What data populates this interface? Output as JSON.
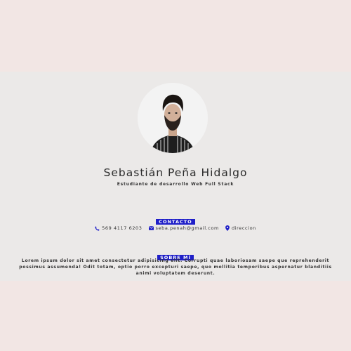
{
  "profile": {
    "name": "Sebastián Peña Hidalgo",
    "subtitle": "Estudiante de desarrollo Web Full Stack"
  },
  "contact": {
    "heading": "CONTACTO",
    "phone": "569 4117 6203",
    "email": "seba.penah@gmail.com",
    "address": "direccion",
    "icons": [
      "phone-icon",
      "mail-icon",
      "location-pin-icon"
    ],
    "accent": "#1f1fc8"
  },
  "about": {
    "heading": "SOBRE MÍ",
    "text": "Lorem ipsum dolor sit amet consectetur adipisicing elit. Corrupti quae laboriosam saepe que reprehenderit possimus assumenda! Odit totam, optio porro excepturi saepe, quo mollitia temporibus aspernatur blanditiis animi voluptatem deserunt."
  }
}
